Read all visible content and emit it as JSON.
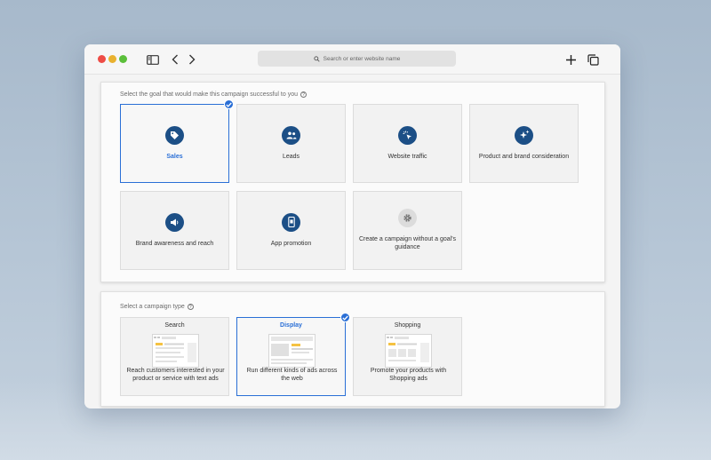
{
  "browser": {
    "address_placeholder": "Search or enter website name"
  },
  "goals": {
    "prompt": "Select the goal that would make this campaign successful to you",
    "options": [
      {
        "label": "Sales",
        "icon": "tag-icon",
        "selected": true
      },
      {
        "label": "Leads",
        "icon": "people-icon",
        "selected": false
      },
      {
        "label": "Website traffic",
        "icon": "cursor-click-icon",
        "selected": false
      },
      {
        "label": "Product and brand consideration",
        "icon": "sparkle-icon",
        "selected": false
      },
      {
        "label": "Brand awareness and reach",
        "icon": "megaphone-icon",
        "selected": false
      },
      {
        "label": "App promotion",
        "icon": "phone-icon",
        "selected": false
      },
      {
        "label": "Create a campaign without a goal's guidance",
        "icon": "gear-icon",
        "selected": false
      }
    ]
  },
  "campaign_types": {
    "prompt": "Select a campaign type",
    "options": [
      {
        "title": "Search",
        "description": "Reach customers interested in your product or service with text ads",
        "selected": false
      },
      {
        "title": "Display",
        "description": "Run different kinds of ads across the web",
        "selected": true
      },
      {
        "title": "Shopping",
        "description": "Promote your products with Shopping ads",
        "selected": false
      }
    ]
  },
  "colors": {
    "accent": "#2a6fd6",
    "icon_circle": "#1c4f86"
  }
}
